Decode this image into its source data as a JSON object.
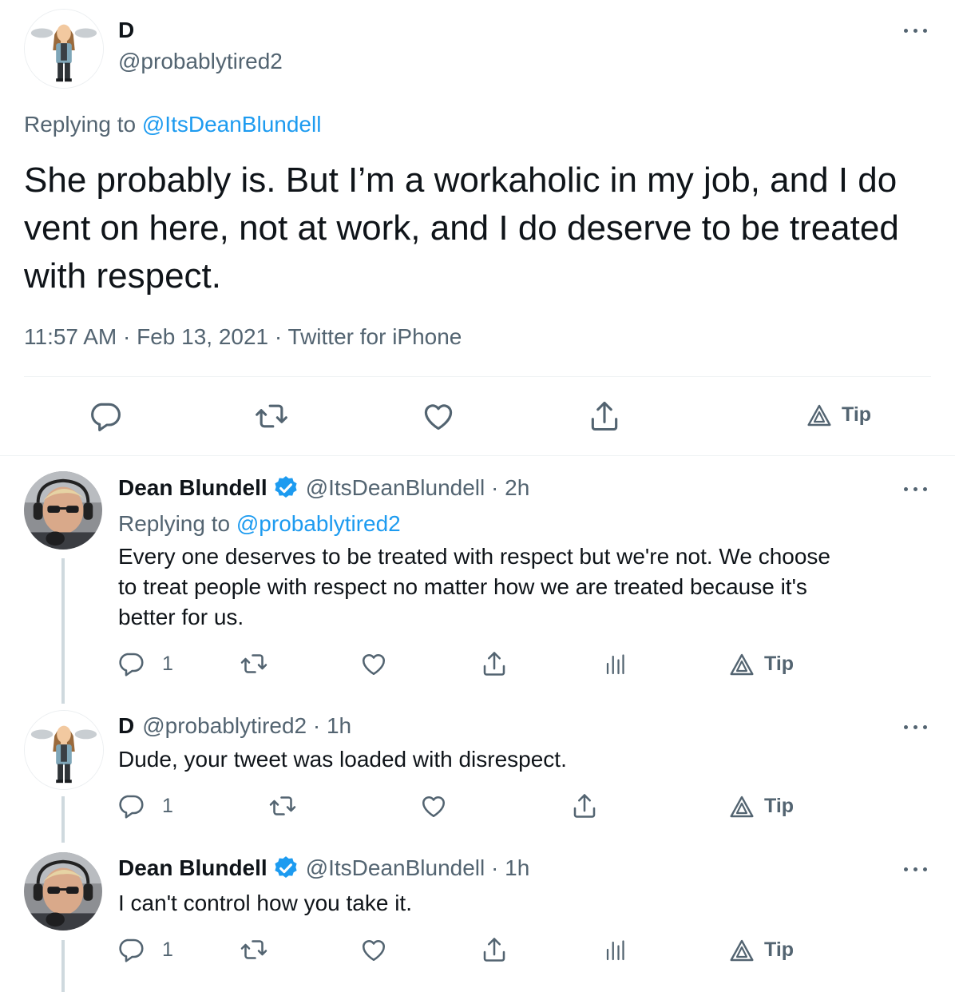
{
  "main_tweet": {
    "display_name": "D",
    "handle": "@probablytired2",
    "replying_prefix": "Replying to",
    "replying_to": "@ItsDeanBlundell",
    "text_lines": [
      "She probably is. But I’m a workaholic in my job, and I do",
      "vent on here, not at work, and I do deserve to be treated",
      "with respect."
    ],
    "meta": "11:57 AM · Feb 13, 2021 · Twitter for iPhone",
    "tip_label": "Tip"
  },
  "replies": [
    {
      "display_name": "Dean Blundell",
      "handle_time": "@ItsDeanBlundell · 2h",
      "replying_prefix": "Replying to",
      "replying_to": "@probablytired2",
      "text_lines": [
        "Every one deserves to be treated with respect but we're not. We choose",
        "to treat people with respect no matter how we are treated because it's",
        "better for us."
      ],
      "reply_count": "1",
      "tip_label": "Tip"
    },
    {
      "display_name": "D",
      "handle_time": "@probablytired2 · 1h",
      "text": "Dude, your tweet was loaded with disrespect.",
      "reply_count": "1",
      "tip_label": "Tip"
    },
    {
      "display_name": "Dean Blundell",
      "handle_time": "@ItsDeanBlundell · 1h",
      "text": "I can't control how you take it.",
      "reply_count": "1",
      "tip_label": "Tip"
    }
  ],
  "colors": {
    "link": "#1d9bf0",
    "muted": "#536471",
    "verified": "#1d9bf0",
    "divider": "#cfd9de"
  },
  "icons": [
    "reply-icon",
    "retweet-icon",
    "like-icon",
    "share-icon",
    "analytics-icon",
    "tip-icon",
    "more-icon",
    "verified-badge-icon"
  ]
}
